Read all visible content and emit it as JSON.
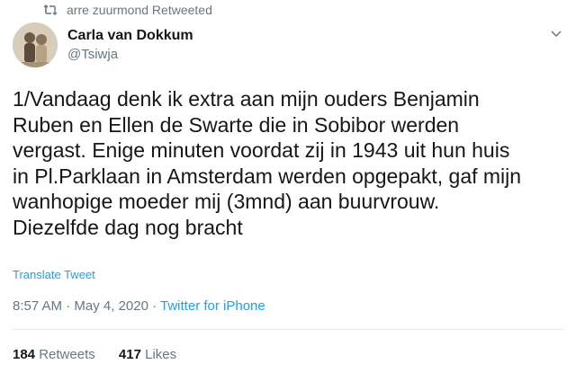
{
  "retweet_context": {
    "icon": "retweet-icon",
    "text": "arre zuurmond Retweeted"
  },
  "author": {
    "name": "Carla van Dokkum",
    "handle": "@Tsiwja",
    "avatar_icon": "avatar"
  },
  "tweet": {
    "text": "1/Vandaag denk ik extra aan mijn ouders Benjamin\nRuben en Ellen de Swarte die in Sobibor werden\nvergast. Enige minuten voordat zij in 1943 uit hun huis\nin Pl.Parklaan in Amsterdam werden opgepakt, gaf mijn\nwanhopige moeder mij (3mnd) aan buurvrouw.\nDiezelfde dag nog bracht",
    "translate_label": "Translate Tweet"
  },
  "meta": {
    "time": "8:57 AM",
    "separator1": " · ",
    "date": "May 4, 2020",
    "separator2": " · ",
    "source": "Twitter for iPhone"
  },
  "stats": {
    "retweets_count": "184",
    "retweets_label": "Retweets",
    "likes_count": "417",
    "likes_label": "Likes"
  },
  "colors": {
    "accent": "#1da1f2",
    "secondary_text": "#657786",
    "primary_text": "#14171a"
  }
}
